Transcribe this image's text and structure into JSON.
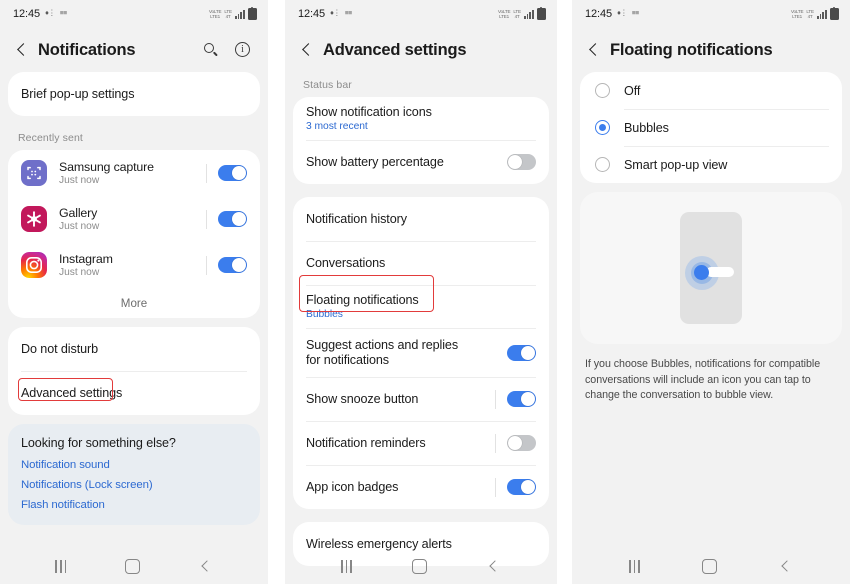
{
  "colors": {
    "accent_blue": "#3b7ded",
    "link_blue": "#2d6ad1",
    "annotation_red": "#e23b3b",
    "panel_bg": "#f2f2f2",
    "card_bg": "#ffffff",
    "help_card_bg": "#e8edf2"
  },
  "status_bar": {
    "time": "12:45",
    "left_icons": [
      "mic-status-icon",
      "sim-status-icon"
    ],
    "volte_line1": "VoLTE",
    "volte_line2": "LTE1",
    "network_label": "LTE",
    "network_sub": "4T",
    "signal_icon": "signal-bars-icon",
    "battery_icon": "battery-icon"
  },
  "panel1": {
    "title": "Notifications",
    "back_icon": "back-chevron-icon",
    "actions": [
      {
        "name": "search-icon",
        "label": "Search"
      },
      {
        "name": "info-icon",
        "label": "About"
      }
    ],
    "brief_popup": "Brief pop-up settings",
    "recently_sent_label": "Recently sent",
    "apps": [
      {
        "name": "Samsung capture",
        "time": "Just now",
        "icon": "samsung-capture-icon",
        "toggle": true
      },
      {
        "name": "Gallery",
        "time": "Just now",
        "icon": "gallery-icon",
        "toggle": true
      },
      {
        "name": "Instagram",
        "time": "Just now",
        "icon": "instagram-icon",
        "toggle": true
      }
    ],
    "more_label": "More",
    "do_not_disturb": "Do not disturb",
    "advanced_settings": "Advanced settings",
    "help": {
      "title": "Looking for something else?",
      "links": [
        "Notification sound",
        "Notifications (Lock screen)",
        "Flash notification"
      ]
    }
  },
  "panel2": {
    "title": "Advanced settings",
    "back_icon": "back-chevron-icon",
    "status_bar_section_label": "Status bar",
    "status_bar_rows": [
      {
        "title": "Show notification icons",
        "sub": "3 most recent",
        "control": "none"
      },
      {
        "title": "Show battery percentage",
        "control": "toggle",
        "toggle": false
      }
    ],
    "main_rows": [
      {
        "title": "Notification history",
        "control": "none"
      },
      {
        "title": "Conversations",
        "control": "none"
      },
      {
        "title": "Floating notifications",
        "sub": "Bubbles",
        "control": "none",
        "highlighted": true
      },
      {
        "title": "Suggest actions and replies for notifications",
        "control": "toggle",
        "toggle": true
      },
      {
        "title": "Show snooze button",
        "control": "toggle",
        "toggle": true
      },
      {
        "title": "Notification reminders",
        "control": "toggle",
        "toggle": false
      },
      {
        "title": "App icon badges",
        "control": "toggle",
        "toggle": true
      }
    ],
    "last_rows": [
      {
        "title": "Wireless emergency alerts",
        "control": "none"
      }
    ]
  },
  "panel3": {
    "title": "Floating notifications",
    "back_icon": "back-chevron-icon",
    "options": [
      {
        "label": "Off",
        "selected": false
      },
      {
        "label": "Bubbles",
        "selected": true
      },
      {
        "label": "Smart pop-up view",
        "selected": false
      }
    ],
    "illustration_name": "bubble-preview-illustration",
    "description": "If you choose Bubbles, notifications for compatible conversations will include an icon you can tap to change the conversation to bubble view."
  },
  "nav_bar": {
    "recents_icon": "recents-icon",
    "home_icon": "home-icon",
    "back_icon": "nav-back-icon"
  }
}
